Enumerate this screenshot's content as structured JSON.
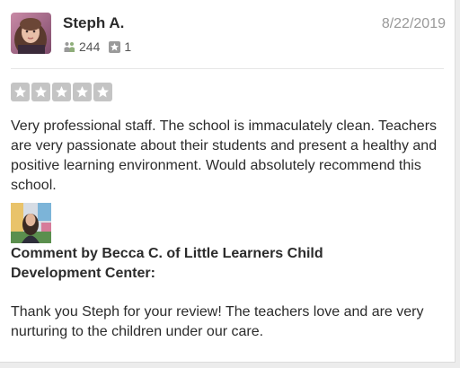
{
  "review": {
    "user_name": "Steph A.",
    "date": "8/22/2019",
    "friends_count": "244",
    "reviews_count": "1",
    "rating": 5,
    "rating_max": 5,
    "text": "Very professional staff. The school is immaculately clean. Teachers are very passionate about their students and present a healthy and positive learning environment. Would absolutely recommend this school."
  },
  "owner_comment": {
    "heading": "Comment by Becca C. of Little Learners Child Development Center:",
    "text": "Thank you Steph for your review! The teachers love and are very nurturing to the children under our care."
  },
  "icons": {
    "friends": "friends-icon",
    "reviews": "review-count-icon",
    "star": "star-icon"
  },
  "colors": {
    "star_box": "#c4c4c4",
    "text": "#2b2b2b",
    "date": "#999999"
  }
}
